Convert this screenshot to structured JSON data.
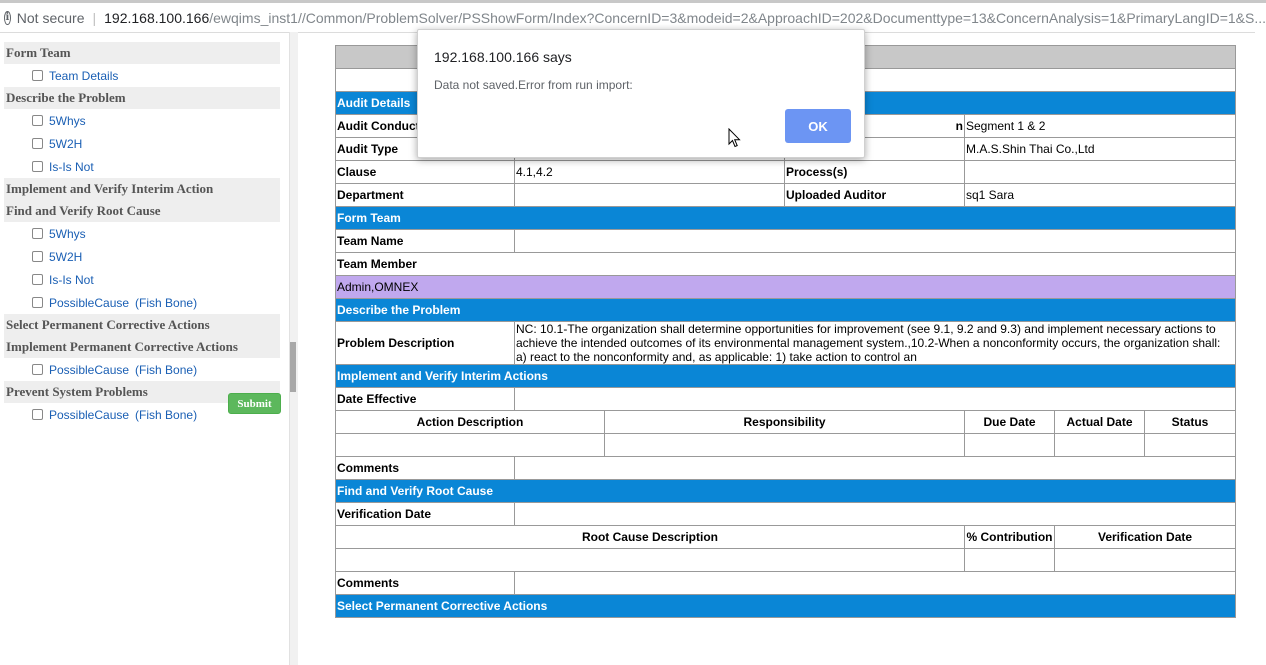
{
  "browser": {
    "security_text": "Not secure",
    "url_host": "192.168.100.166",
    "url_path": "/ewqims_inst1//Common/ProblemSolver/PSShowForm/Index?ConcernID=3&modeid=2&ApproachID=202&Documenttype=13&ConcernAnalysis=1&PrimaryLangID=1&S..."
  },
  "sidebar": {
    "form_team": {
      "title": "Form Team",
      "items": [
        "Team Details"
      ]
    },
    "describe": {
      "title": "Describe the Problem",
      "items": [
        "5Whys",
        "5W2H",
        "Is-Is Not"
      ]
    },
    "interim": {
      "title": "Implement and Verify Interim Action"
    },
    "root_cause": {
      "title": "Find and Verify Root Cause",
      "items": [
        "5Whys",
        "5W2H",
        "Is-Is Not",
        "PossibleCause"
      ],
      "fishbone": "Fish Bone"
    },
    "select_pca": {
      "title": "Select Permanent Corrective Actions"
    },
    "impl_pca": {
      "title": "Implement Permanent Corrective Actions",
      "item": "PossibleCause",
      "fishbone": "Fish Bone"
    },
    "prevent": {
      "title": "Prevent System Problems",
      "item": "PossibleCause",
      "fishbone": "Fish Bone"
    },
    "submit_label": "Submit"
  },
  "form": {
    "audit_details": "Audit Details",
    "audit_conducted_label": "Audit Conduct",
    "location_label_partial": "n",
    "location_value": "Segment 1 & 2",
    "audit_type_label": "Audit Type",
    "supplier_value": "M.A.S.Shin Thai Co.,Ltd",
    "clause_label": "Clause",
    "clause_value": "4.1,4.2",
    "process_label": "Process(s)",
    "department_label": "Department",
    "uploaded_auditor_label": "Uploaded Auditor",
    "uploaded_auditor_value": "sq1 Sara",
    "form_team": "Form Team",
    "team_name_label": "Team Name",
    "team_member_label": "Team Member",
    "team_member_value": "Admin,OMNEX",
    "describe_problem": "Describe the Problem",
    "problem_desc_label": "Problem Description",
    "problem_desc_value": "NC: 10.1-The organization shall determine opportunities for improvement (see 9.1, 9.2 and 9.3) and implement necessary actions to achieve the intended outcomes of its environmental management system.,10.2-When a nonconformity occurs, the organization shall: a) react to the nonconformity and, as applicable: 1) take action to control an",
    "interim_actions": "Implement and Verify Interim Actions",
    "date_effective_label": "Date Effective",
    "interim_cols": [
      "Action Description",
      "Responsibility",
      "Due Date",
      "Actual Date",
      "Status"
    ],
    "comments_label": "Comments",
    "root_cause": "Find and Verify Root Cause",
    "verification_date_label": "Verification Date",
    "root_cols": [
      "Root Cause Description",
      "% Contribution",
      "Verification Date"
    ],
    "select_pca": "Select Permanent Corrective Actions"
  },
  "dialog": {
    "title": "192.168.100.166 says",
    "message": "Data not saved.Error from run import:",
    "ok_label": "OK"
  }
}
